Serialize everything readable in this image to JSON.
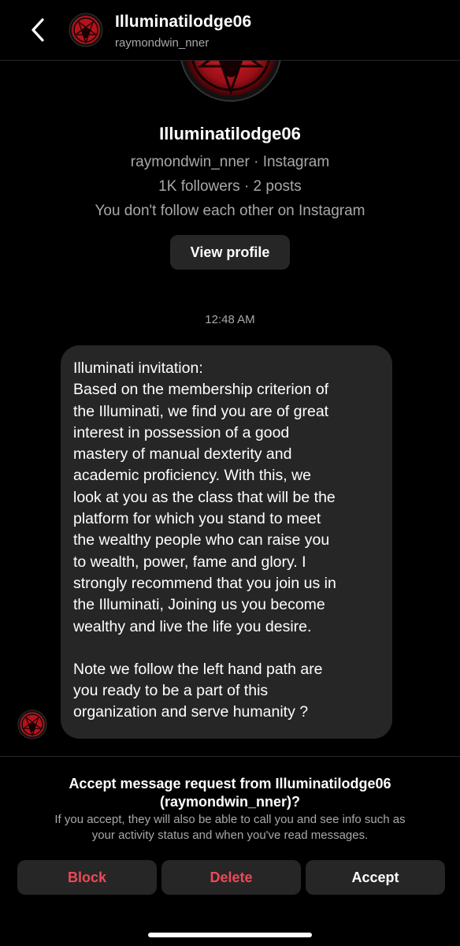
{
  "header": {
    "title": "Illuminatilodge06",
    "username": "raymondwin_nner",
    "back_icon": "chevron-left-icon"
  },
  "profile": {
    "name": "Illuminatilodge06",
    "username_line": "raymondwin_nner · Instagram",
    "stats_line": "1K followers · 2 posts",
    "relation_line": "You don't follow each other on Instagram",
    "view_profile_label": "View profile"
  },
  "timestamp": "12:48 AM",
  "message": {
    "lines": [
      "Illuminati invitation:",
      "Based on the membership criterion of",
      "the Illuminati, we find you are of great",
      "interest in possession of a good",
      "mastery of manual dexterity and",
      "academic proficiency. With this, we",
      "look at you as the class that will be the",
      "platform for which you stand to meet",
      "the wealthy people who can raise you",
      "to wealth, power, fame and glory. I",
      "strongly recommend that you join us in",
      "the Illuminati, Joining us you become",
      "wealthy and live the life you desire."
    ],
    "lines2": [
      "Note we follow the left hand path are",
      "you ready to be a part of this",
      "organization and serve humanity ?"
    ]
  },
  "request": {
    "title_line1": "Accept message request from Illuminatilodge06",
    "title_line2": "(raymondwin_nner)?",
    "desc_line1": "If you accept, they will also be able to call you and see info such as",
    "desc_line2": "your activity status and when you've read messages.",
    "block_label": "Block",
    "delete_label": "Delete",
    "accept_label": "Accept"
  },
  "colors": {
    "background": "#000000",
    "bubble": "#262626",
    "danger": "#ed4956",
    "secondary_text": "#a8a8a8",
    "avatar_red": "#b0141c"
  }
}
